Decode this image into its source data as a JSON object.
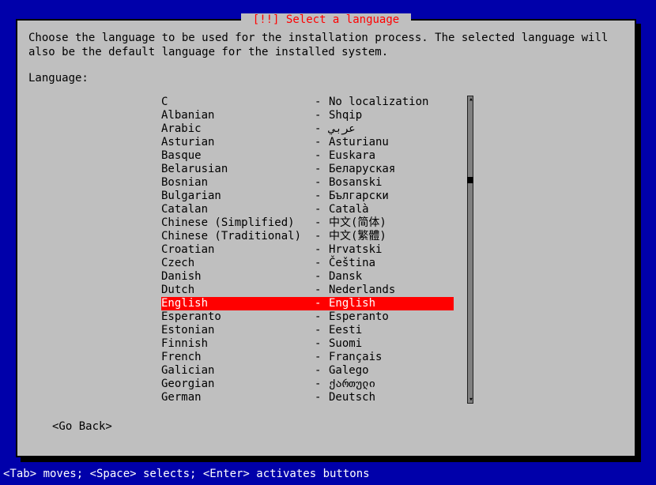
{
  "dialog": {
    "title_raw": "[!!] Select a language",
    "title_prefix": " [!!] ",
    "title_text": "Select a language",
    "title_suffix": " ",
    "instructions": "Choose the language to be used for the installation process. The selected language will\nalso be the default language for the installed system.",
    "label": "Language:",
    "go_back": "<Go Back>"
  },
  "languages": [
    {
      "eng": "C",
      "sep": "-",
      "loc": "No localization",
      "selected": false
    },
    {
      "eng": "Albanian",
      "sep": "-",
      "loc": "Shqip",
      "selected": false
    },
    {
      "eng": "Arabic",
      "sep": "-",
      "loc": "عربي",
      "selected": false
    },
    {
      "eng": "Asturian",
      "sep": "-",
      "loc": "Asturianu",
      "selected": false
    },
    {
      "eng": "Basque",
      "sep": "-",
      "loc": "Euskara",
      "selected": false
    },
    {
      "eng": "Belarusian",
      "sep": "-",
      "loc": "Беларуская",
      "selected": false
    },
    {
      "eng": "Bosnian",
      "sep": "-",
      "loc": "Bosanski",
      "selected": false
    },
    {
      "eng": "Bulgarian",
      "sep": "-",
      "loc": "Български",
      "selected": false
    },
    {
      "eng": "Catalan",
      "sep": "-",
      "loc": "Català",
      "selected": false
    },
    {
      "eng": "Chinese (Simplified)",
      "sep": "-",
      "loc": "中文(简体)",
      "selected": false
    },
    {
      "eng": "Chinese (Traditional)",
      "sep": "-",
      "loc": "中文(繁體)",
      "selected": false
    },
    {
      "eng": "Croatian",
      "sep": "-",
      "loc": "Hrvatski",
      "selected": false
    },
    {
      "eng": "Czech",
      "sep": "-",
      "loc": "Čeština",
      "selected": false
    },
    {
      "eng": "Danish",
      "sep": "-",
      "loc": "Dansk",
      "selected": false
    },
    {
      "eng": "Dutch",
      "sep": "-",
      "loc": "Nederlands",
      "selected": false
    },
    {
      "eng": "English",
      "sep": "-",
      "loc": "English",
      "selected": true
    },
    {
      "eng": "Esperanto",
      "sep": "-",
      "loc": "Esperanto",
      "selected": false
    },
    {
      "eng": "Estonian",
      "sep": "-",
      "loc": "Eesti",
      "selected": false
    },
    {
      "eng": "Finnish",
      "sep": "-",
      "loc": "Suomi",
      "selected": false
    },
    {
      "eng": "French",
      "sep": "-",
      "loc": "Français",
      "selected": false
    },
    {
      "eng": "Galician",
      "sep": "-",
      "loc": "Galego",
      "selected": false
    },
    {
      "eng": "Georgian",
      "sep": "-",
      "loc": "ქართული",
      "selected": false
    },
    {
      "eng": "German",
      "sep": "-",
      "loc": "Deutsch",
      "selected": false
    }
  ],
  "help_bar": "<Tab> moves; <Space> selects; <Enter> activates buttons",
  "colors": {
    "background": "#0000aa",
    "dialog_bg": "#bfbfbf",
    "title_fg": "#ff0000",
    "highlight_bg": "#ff0000",
    "highlight_fg": "#ffffff"
  }
}
